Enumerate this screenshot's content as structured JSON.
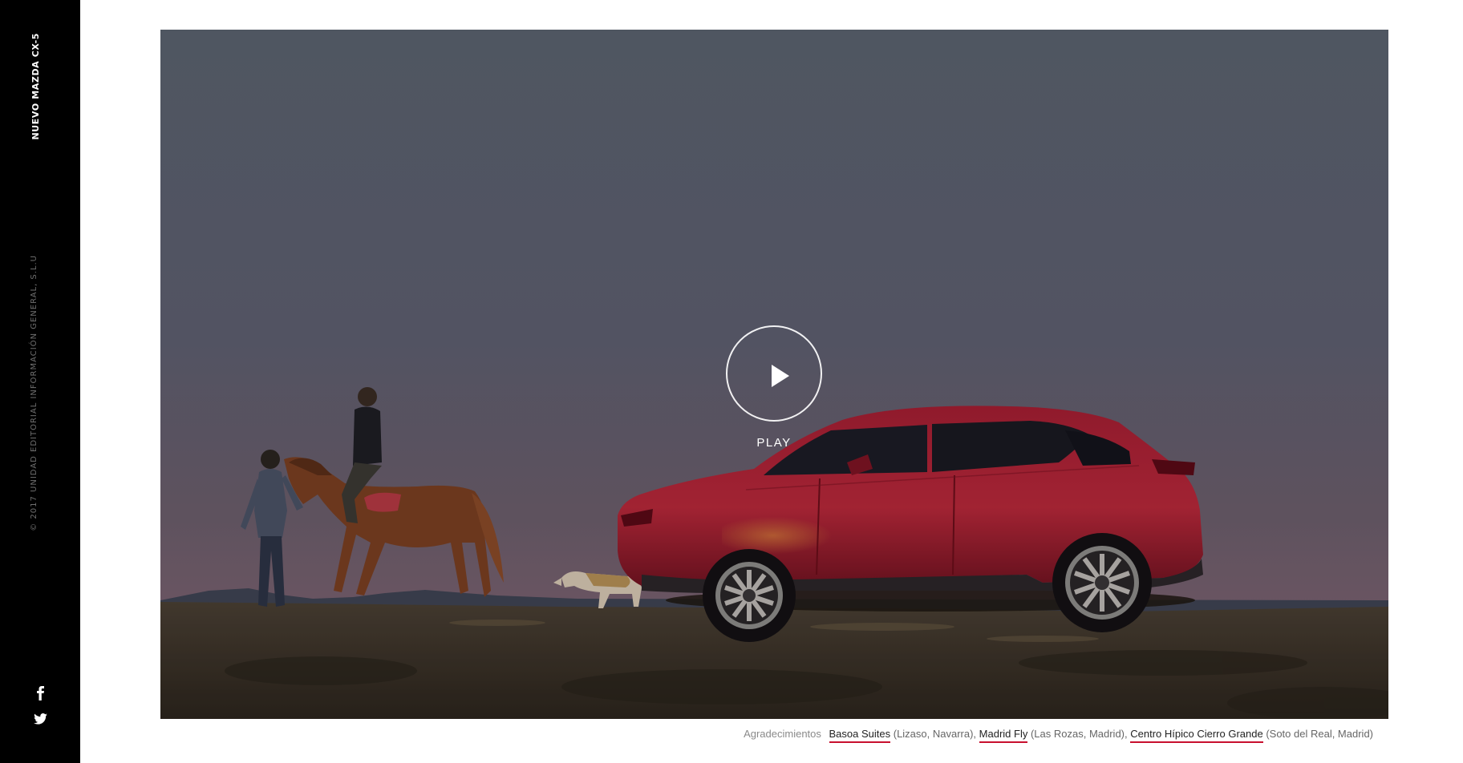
{
  "sidebar": {
    "title": "NUEVO MAZDA CX-5",
    "copyright": "© 2017 UNIDAD EDITORIAL INFORMACIÓN GENERAL, S.L.U",
    "social": [
      {
        "icon": "facebook-icon",
        "glyph": "f"
      },
      {
        "icon": "twitter-icon",
        "glyph": "bird"
      }
    ]
  },
  "video": {
    "play_label": "PLAY",
    "scene": "sunset meadow with riders, horse, dog and red SUV"
  },
  "credits": {
    "lead": "Agradecimientos",
    "items": [
      {
        "name": "Basoa Suites",
        "location": " (Lizaso, Navarra),"
      },
      {
        "name": "Madrid Fly",
        "location": " (Las Rozas, Madrid),"
      },
      {
        "name": "Centro Hípico Cierro Grande",
        "location": " (Soto del Real, Madrid)"
      }
    ]
  },
  "colors": {
    "sidebar_bg": "#000000",
    "link_underline": "#c8102e",
    "car": "#9e1a2c"
  }
}
